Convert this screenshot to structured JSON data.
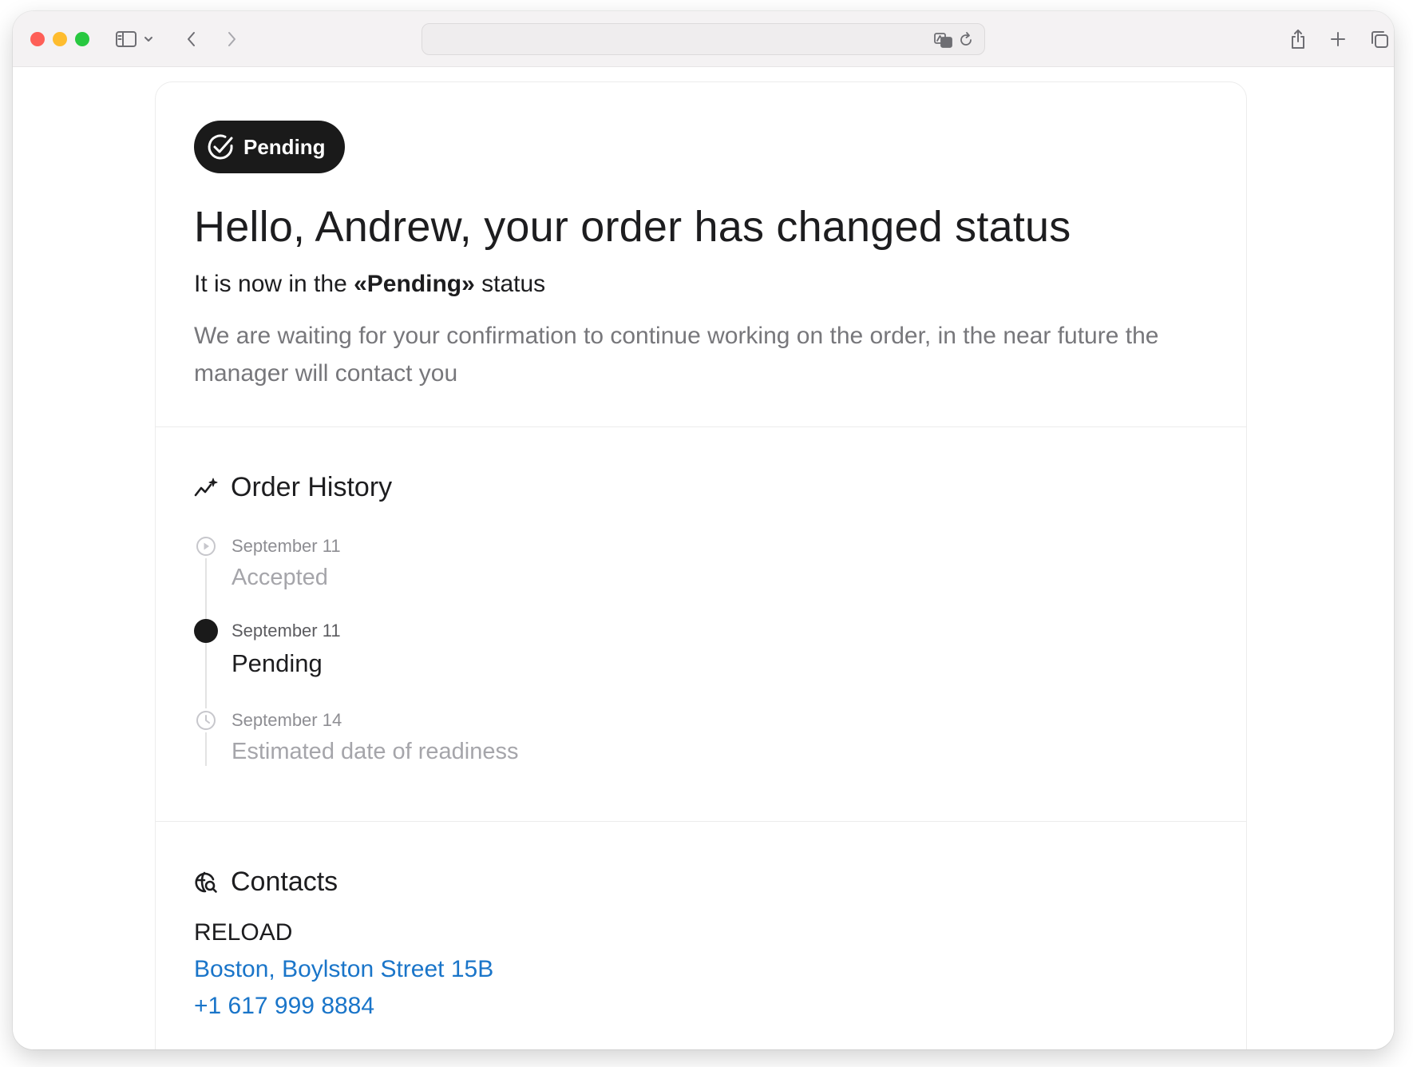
{
  "browser": {
    "url": "",
    "traffic_lights": {
      "close": "#fe5f57",
      "minimize": "#febc2e",
      "zoom": "#28c840"
    }
  },
  "header": {
    "badge_label": "Pending",
    "title": "Hello, Andrew, your order has changed status",
    "status_prefix": "It is now in the ",
    "status_value": "«Pending»",
    "status_suffix": " status",
    "description": "We are waiting for your confirmation to continue working on the order, in the near future the manager will contact you"
  },
  "history": {
    "title": "Order History",
    "items": [
      {
        "date": "September 11",
        "label": "Accepted",
        "icon": "play-circle-icon",
        "state": "done"
      },
      {
        "date": "September 11",
        "label": "Pending",
        "icon": "filled-dot",
        "state": "current"
      },
      {
        "date": "September 14",
        "label": "Estimated date of readiness",
        "icon": "clock-icon",
        "state": "upcoming"
      }
    ]
  },
  "contacts": {
    "title": "Contacts",
    "company": "RELOAD",
    "address": "Boston, Boylston Street 15B",
    "phone": "+1 617 999 8884"
  },
  "colors": {
    "badge_bg": "#1a1a1a",
    "link": "#1a75c9",
    "muted_text": "#77777b"
  }
}
